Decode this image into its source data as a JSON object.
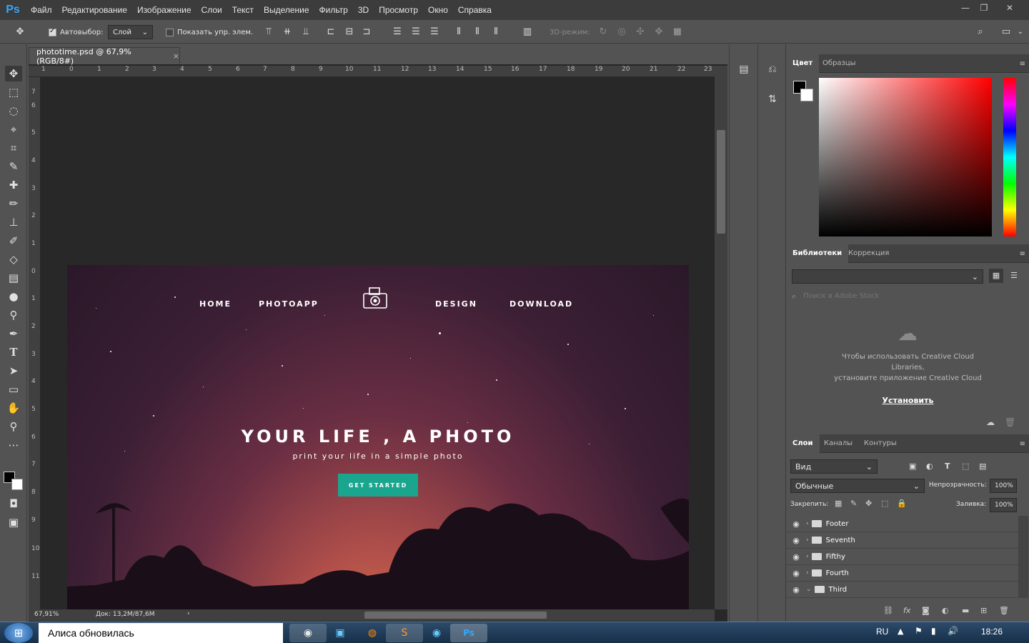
{
  "menubar": {
    "logo": "Ps",
    "items": [
      "Файл",
      "Редактирование",
      "Изображение",
      "Слои",
      "Текст",
      "Выделение",
      "Фильтр",
      "3D",
      "Просмотр",
      "Окно",
      "Справка"
    ],
    "win_min": "—",
    "win_restore": "❐",
    "win_close": "✕"
  },
  "options": {
    "autoselect_label": "Автовыбор:",
    "autoselect_value": "Слой",
    "show_controls": "Показать упр. элем.",
    "mode3d": "3D-режим:"
  },
  "doc": {
    "tab_title": "phototime.psd @ 67,9% (RGB/8#)",
    "close": "×",
    "zoom": "67,91%",
    "doc_size": "Док: 13,2M/87,6M"
  },
  "ruler": {
    "top": [
      "1",
      "0",
      "1",
      "2",
      "3",
      "4",
      "5",
      "6",
      "7",
      "8",
      "9",
      "10",
      "11",
      "12",
      "13",
      "14",
      "15",
      "16",
      "17",
      "18",
      "19",
      "20",
      "21",
      "22",
      "23"
    ],
    "left": [
      "7",
      "6",
      "5",
      "4",
      "3",
      "2",
      "1",
      "0",
      "1",
      "2",
      "3",
      "4",
      "5",
      "6",
      "7",
      "8",
      "9",
      "10",
      "11"
    ]
  },
  "site": {
    "nav": [
      "HOME",
      "PHOTOAPP",
      "DESIGN",
      "DOWNLOAD"
    ],
    "hero_title": "YOUR LIFE , A PHOTO",
    "hero_sub": "print your life in a simple photo",
    "cta": "GET STARTED"
  },
  "color_panel": {
    "tabs": [
      "Цвет",
      "Образцы"
    ]
  },
  "libraries": {
    "tabs": [
      "Библиотеки",
      "Коррекция"
    ],
    "search_placeholder": "Поиск в Adobe Stock",
    "message_line1": "Чтобы использовать Creative Cloud",
    "message_line2": "Libraries,",
    "message_line3": "установите приложение Creative Cloud",
    "install": "Установить"
  },
  "layers": {
    "tabs": [
      "Слои",
      "Каналы",
      "Контуры"
    ],
    "filter": "Вид",
    "blend": "Обычные",
    "opacity_label": "Непрозрачность:",
    "opacity": "100%",
    "lock_label": "Закрепить:",
    "fill_label": "Заливка:",
    "fill": "100%",
    "items": [
      "Footer",
      "Seventh",
      "Fifthy",
      "Fourth",
      "Third"
    ]
  },
  "taskbar": {
    "notification": "Алиса обновилась",
    "lang": "RU",
    "time": "18:26"
  },
  "colors": {
    "accent": "#1aa58f",
    "ps_blue": "#31a8ff"
  }
}
